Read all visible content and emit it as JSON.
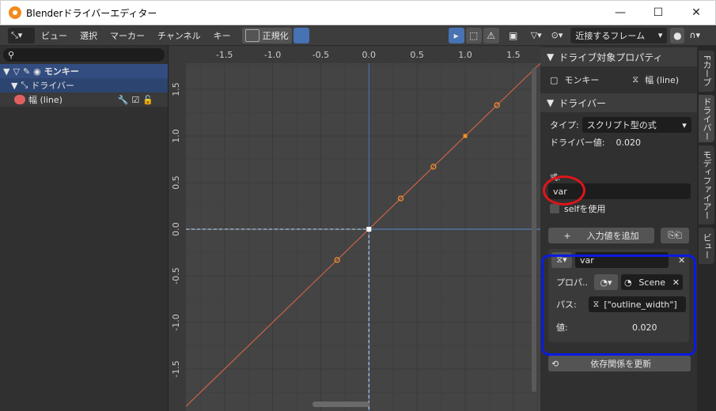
{
  "window": {
    "title": "Blenderドライバーエディター",
    "min": "—",
    "max": "☐",
    "close": "✕"
  },
  "header": {
    "menus": [
      "ビュー",
      "選択",
      "マーカー",
      "チャンネル",
      "キー"
    ],
    "normalize_label": "正規化",
    "snap_label": "近接するフレーム"
  },
  "outliner": {
    "object": "モンキー",
    "driver_group": "ドライバー",
    "channel": "幅 (line)"
  },
  "graph": {
    "x_ticks": [
      "-1.5",
      "-1.0",
      "-0.5",
      "0.0",
      "0.5",
      "1.0",
      "1.5"
    ],
    "y_ticks": [
      "1.5",
      "1.0",
      "0.5",
      "0.0",
      "-0.5",
      "-1.0",
      "-1.5"
    ],
    "chart_data": {
      "type": "line",
      "x": [
        -0.33,
        0.0,
        0.33,
        0.67,
        1.0,
        1.33
      ],
      "y": [
        -0.33,
        0.0,
        0.33,
        0.67,
        1.0,
        1.33
      ],
      "xlim": [
        -1.9,
        1.78
      ],
      "ylim": [
        -1.95,
        1.78
      ]
    }
  },
  "props": {
    "section1": "ドライブ対象プロパティ",
    "target_obj": "モンキー",
    "target_prop": "幅 (line)",
    "section2": "ドライバー",
    "type_label": "タイプ:",
    "type_value": "スクリプト型の式",
    "driver_value_label": "ドライバー値:",
    "driver_value": "0.020",
    "expr_label": "式:",
    "expr_value": "var",
    "use_self": "selfを使用",
    "add_input": "入力値を追加",
    "var_name": "var",
    "prop_label": "プロパ..",
    "scene_label": "Scene",
    "path_label": "パス:",
    "path_value": "[\"outline_width\"]",
    "value_label": "値:",
    "value": "0.020",
    "update": "依存関係を更新"
  },
  "tabs": [
    "Fカーブ",
    "ドライバー",
    "モディファイアー",
    "ビュー"
  ],
  "colors": {
    "accent": "#4772b3",
    "curve": "#c06045",
    "point": "#f0902a",
    "annot_red": "#e3131b",
    "annot_blue": "#0a1be3"
  }
}
